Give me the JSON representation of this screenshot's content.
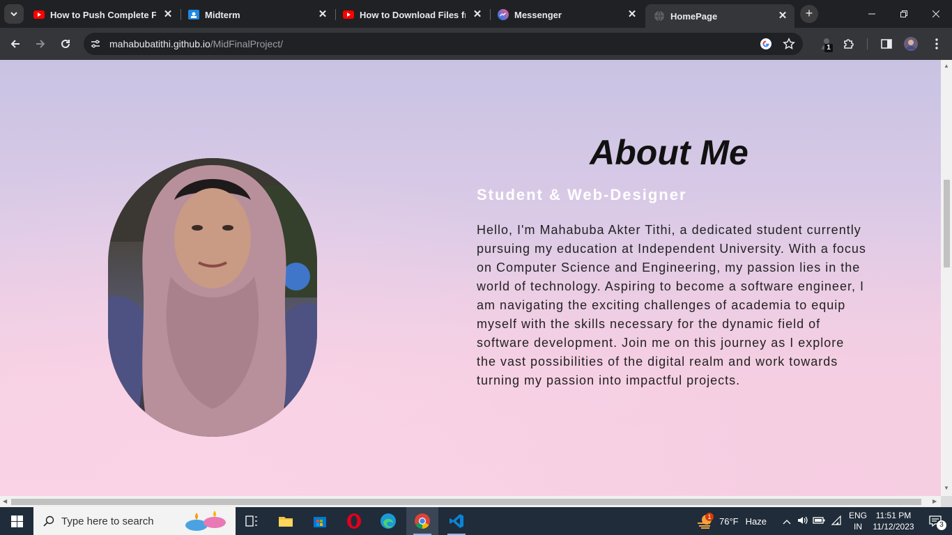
{
  "browser": {
    "tabs": [
      {
        "title": "How to Push Complete Folder",
        "favicon": "youtube-icon"
      },
      {
        "title": "Midterm",
        "favicon": "google-classroom-icon"
      },
      {
        "title": "How to Download Files from",
        "favicon": "youtube-icon"
      },
      {
        "title": "Messenger",
        "favicon": "messenger-icon"
      },
      {
        "title": "HomePage",
        "favicon": "globe-icon",
        "active": true
      }
    ],
    "url_host": "mahabubatithi.github.io",
    "url_path": "/MidFinalProject/",
    "extension_badge": "1"
  },
  "page": {
    "heading": "About Me",
    "subtitle": "Student & Web-Designer",
    "bio": "Hello, I'm Mahabuba Akter Tithi, a dedicated student currently pursuing my education at Independent University. With a focus on Computer Science and Engineering, my passion lies in the world of technology. Aspiring to become a software engineer, I am navigating the exciting challenges of academia to equip myself with the skills necessary for the dynamic field of software development. Join me on this journey as I explore the vast possibilities of the digital realm and work towards turning my passion into impactful projects."
  },
  "taskbar": {
    "search_placeholder": "Type here to search",
    "weather_temp": "76°F",
    "weather_desc": "Haze",
    "weather_badge": "1",
    "lang_top": "ENG",
    "lang_bottom": "IN",
    "time": "11:51 PM",
    "date": "11/12/2023",
    "notification_count": "3"
  },
  "colors": {
    "accent_blue": "#8ab4f8",
    "youtube_red": "#ff0000"
  }
}
